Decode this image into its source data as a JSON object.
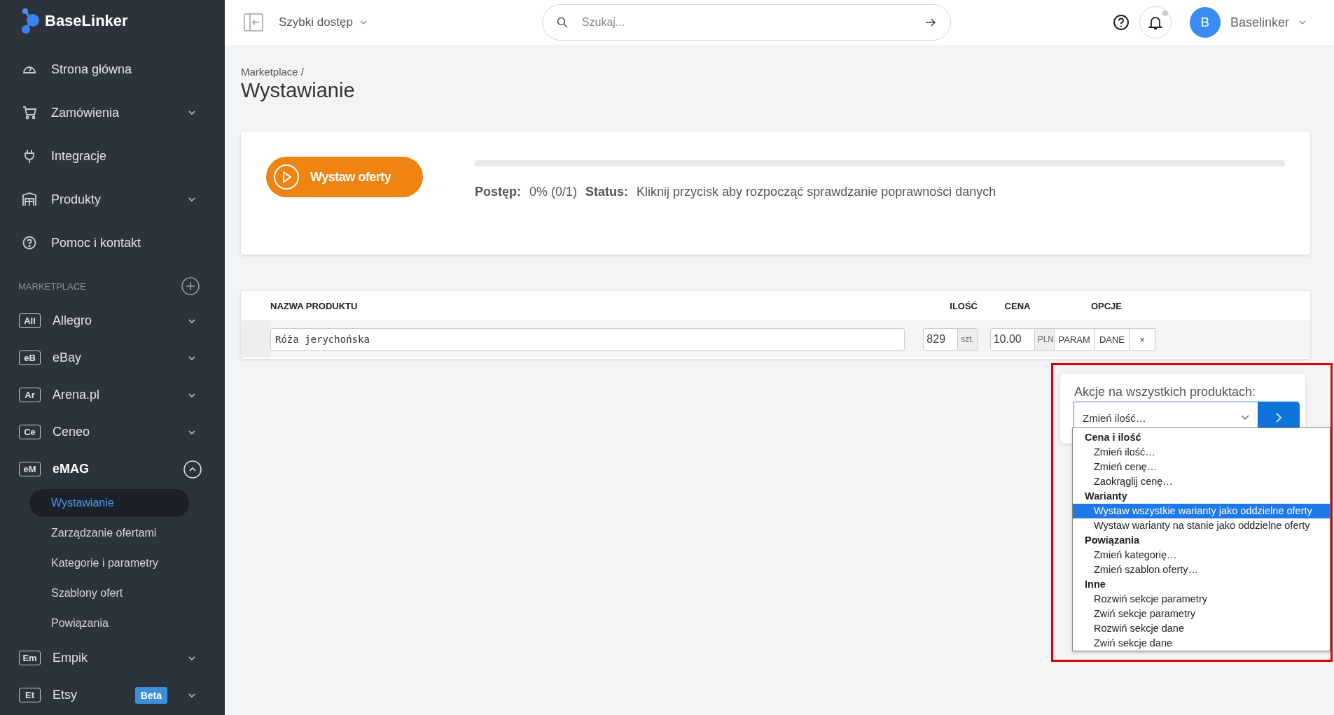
{
  "logo": {
    "text": "BaseLinker"
  },
  "sidebar": {
    "nav": [
      {
        "kind": "dashboard",
        "label": "Strona główna",
        "has_submenu": false
      },
      {
        "kind": "cart",
        "label": "Zamówienia",
        "has_submenu": true
      },
      {
        "kind": "plug",
        "label": "Integracje",
        "has_submenu": false
      },
      {
        "kind": "warehouse",
        "label": "Produkty",
        "has_submenu": true
      },
      {
        "kind": "help",
        "label": "Pomoc i kontakt",
        "has_submenu": false
      }
    ],
    "section_title": "MARKETPLACE",
    "marketplaces": [
      {
        "badge": "All",
        "label": "Allegro",
        "expanded": false
      },
      {
        "badge": "eB",
        "label": "eBay",
        "expanded": false
      },
      {
        "badge": "Ar",
        "label": "Arena.pl",
        "expanded": false
      },
      {
        "badge": "Ce",
        "label": "Ceneo",
        "expanded": false
      },
      {
        "badge": "eM",
        "label": "eMAG",
        "expanded": true,
        "children": [
          {
            "label": "Wystawianie",
            "selected": true
          },
          {
            "label": "Zarządzanie ofertami",
            "selected": false
          },
          {
            "label": "Kategorie i parametry",
            "selected": false
          },
          {
            "label": "Szablony ofert",
            "selected": false
          },
          {
            "label": "Powiązania",
            "selected": false
          }
        ]
      },
      {
        "badge": "Em",
        "label": "Empik",
        "expanded": false
      },
      {
        "badge": "Et",
        "label": "Etsy",
        "expanded": false,
        "tag": "Beta"
      }
    ]
  },
  "topbar": {
    "quick_access": "Szybki dostęp",
    "search": {
      "placeholder": "Szukaj..."
    },
    "notifications": {
      "unread": true
    },
    "user": {
      "avatar": "B",
      "name": "Baselinker"
    }
  },
  "breadcrumb": "Marketplace /",
  "title": "Wystawianie",
  "progress_card": {
    "button": "Wystaw oferty",
    "level": 0,
    "progress_label": "Postęp:",
    "progress_value": "0% (0/1)",
    "status_label": "Status:",
    "status_text": "Kliknij przycisk aby rozpocząć sprawdzanie poprawności danych"
  },
  "table": {
    "columns": [
      "NAZWA PRODUKTU",
      "ILOŚĆ",
      "CENA",
      "OPCJE"
    ],
    "rows": [
      {
        "name": "Róża jerychońska",
        "quantity": "829",
        "unit": "szt.",
        "price": "10.00",
        "currency": "PLN",
        "options": [
          "PARAM",
          "DANE",
          "×"
        ]
      }
    ]
  },
  "bulk_actions": {
    "label": "Akcje na wszystkich produktach:",
    "value": "Zmień ilość…",
    "highlighted": true,
    "groups": [
      {
        "label": "Cena i ilość",
        "options": [
          {
            "label": "Zmień ilość…",
            "selected": false
          },
          {
            "label": "Zmień cenę…",
            "selected": false
          },
          {
            "label": "Zaokrąglij cenę…",
            "selected": false
          }
        ]
      },
      {
        "label": "Warianty",
        "options": [
          {
            "label": "Wystaw wszystkie warianty jako oddzielne oferty",
            "selected": true
          },
          {
            "label": "Wystaw warianty na stanie jako oddzielne oferty",
            "selected": false
          }
        ]
      },
      {
        "label": "Powiązania",
        "options": [
          {
            "label": "Zmień kategorię…",
            "selected": false
          },
          {
            "label": "Zmień szablon oferty…",
            "selected": false
          }
        ]
      },
      {
        "label": "Inne",
        "options": [
          {
            "label": "Rozwiń sekcje parametry",
            "selected": false
          },
          {
            "label": "Zwiń sekcje parametry",
            "selected": false
          },
          {
            "label": "Rozwiń sekcje dane",
            "selected": false
          },
          {
            "label": "Zwiń sekcje dane",
            "selected": false
          }
        ]
      }
    ]
  }
}
